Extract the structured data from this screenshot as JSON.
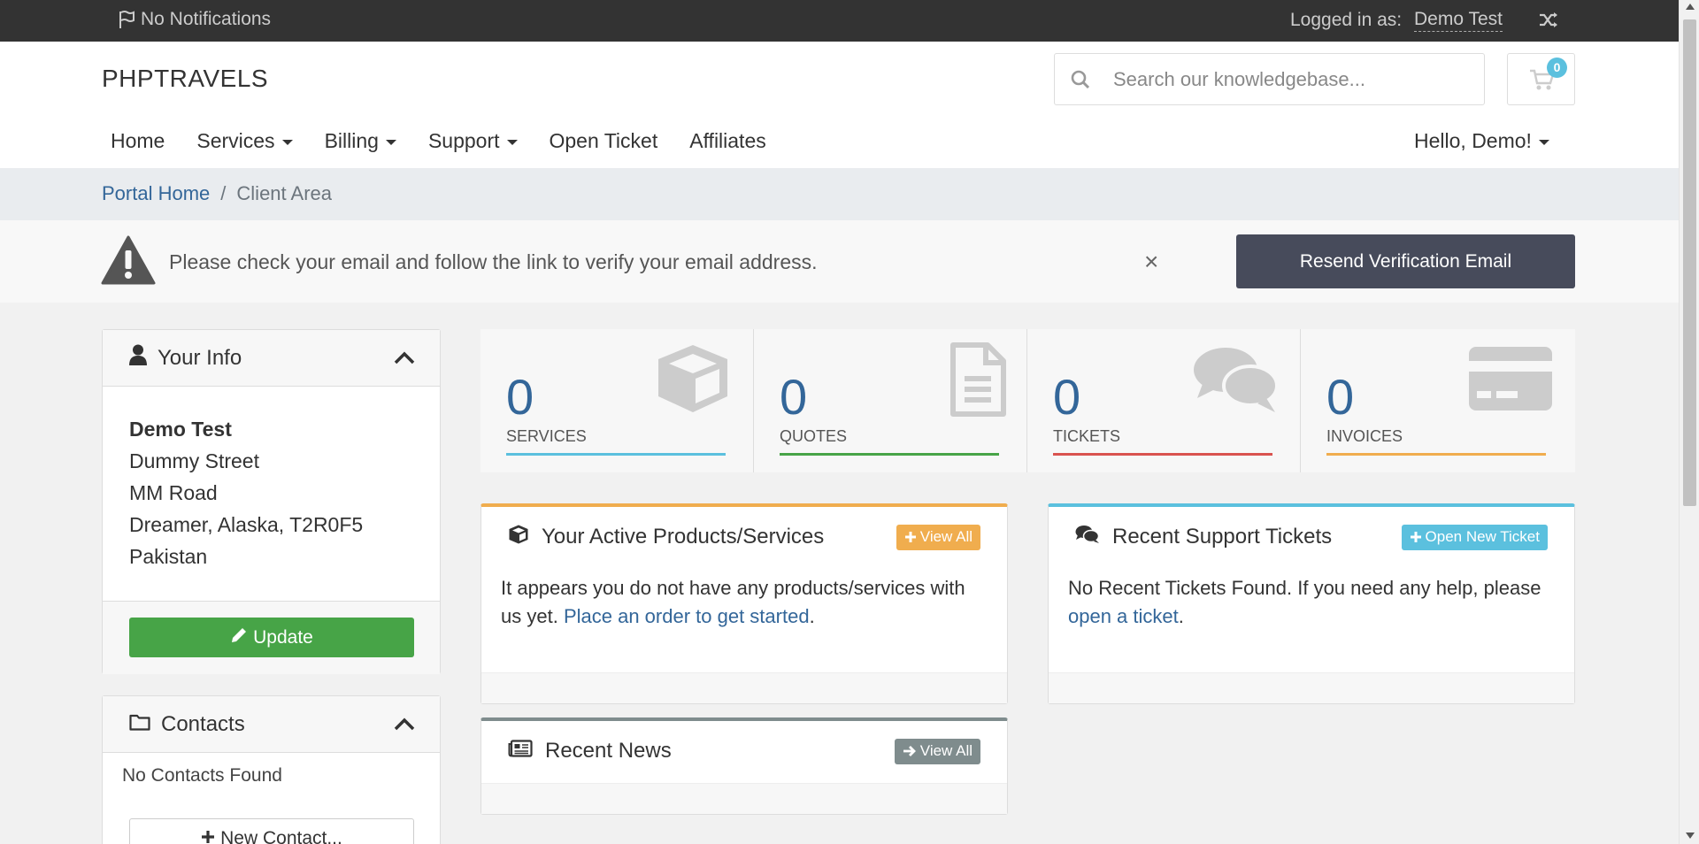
{
  "topbar": {
    "notifications": "No Notifications",
    "logged_in_label": "Logged in as:",
    "user_name": "Demo Test"
  },
  "header": {
    "logo": "PHPTRAVELS",
    "search_placeholder": "Search our knowledgebase...",
    "cart_count": "0"
  },
  "nav": {
    "items": [
      {
        "label": "Home"
      },
      {
        "label": "Services"
      },
      {
        "label": "Billing"
      },
      {
        "label": "Support"
      },
      {
        "label": "Open Ticket"
      },
      {
        "label": "Affiliates"
      }
    ],
    "account": "Hello, Demo!"
  },
  "breadcrumb": {
    "home": "Portal Home",
    "separator": "/",
    "current": "Client Area"
  },
  "alert": {
    "message": "Please check your email and follow the link to verify your email address.",
    "close": "×",
    "button": "Resend Verification Email"
  },
  "your_info": {
    "title": "Your Info",
    "name": "Demo Test",
    "address1": "Dummy Street",
    "address2": "MM Road",
    "city_line": "Dreamer, Alaska, T2R0F5",
    "country": "Pakistan",
    "update_button": "Update"
  },
  "contacts": {
    "title": "Contacts",
    "empty": "No Contacts Found",
    "new_button": "New Contact..."
  },
  "stats": [
    {
      "value": "0",
      "label": "SERVICES",
      "color": "#5bc0de"
    },
    {
      "value": "0",
      "label": "QUOTES",
      "color": "#47a447"
    },
    {
      "value": "0",
      "label": "TICKETS",
      "color": "#d9534f"
    },
    {
      "value": "0",
      "label": "INVOICES",
      "color": "#f0ad4e"
    }
  ],
  "products_panel": {
    "title": "Your Active Products/Services",
    "view_all": "View All",
    "text": "It appears you do not have any products/services with us yet.",
    "link": "Place an order to get started",
    "end": ".",
    "accent": "#f0ad4e"
  },
  "tickets_panel": {
    "title": "Recent Support Tickets",
    "button": "Open New Ticket",
    "text": "No Recent Tickets Found. If you need any help, please",
    "link": "open a ticket",
    "end": ".",
    "accent": "#5bc0de"
  },
  "news_panel": {
    "title": "Recent News",
    "view_all": "View All",
    "accent": "#7f8c8d"
  }
}
